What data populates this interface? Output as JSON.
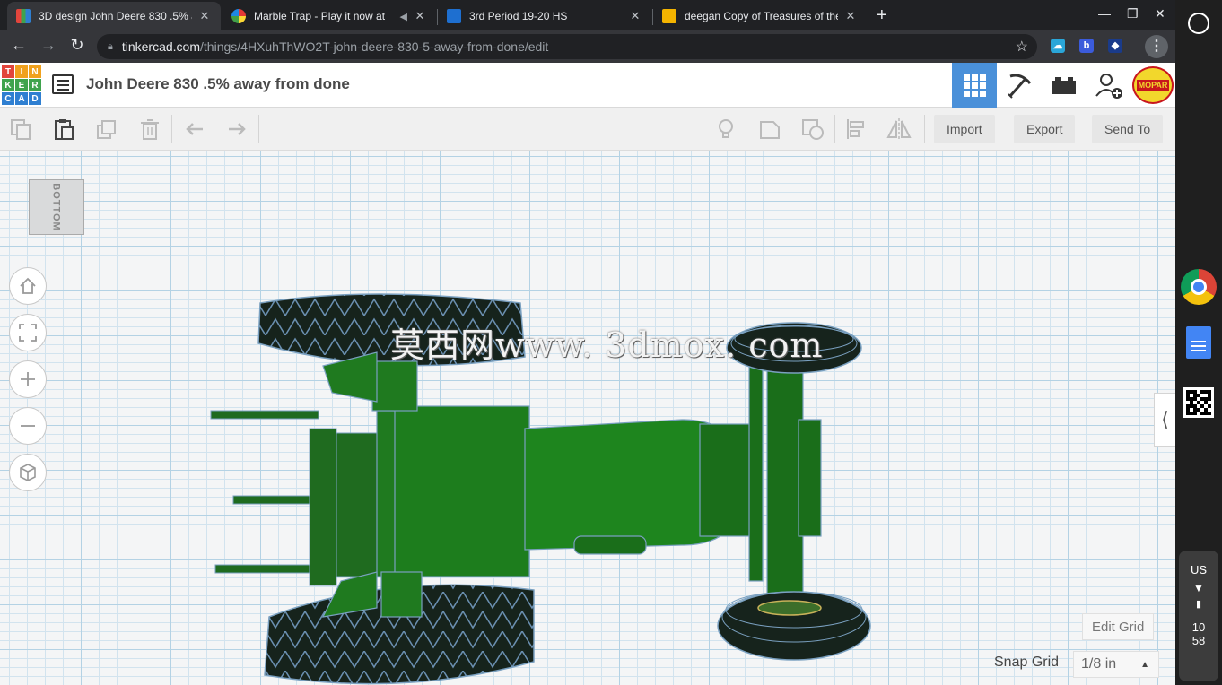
{
  "tabs": [
    {
      "title": "3D design John Deere 830 .5% a",
      "active": true
    },
    {
      "title": "Marble Trap - Play it now at",
      "active": false
    },
    {
      "title": "3rd Period 19-20 HS",
      "active": false
    },
    {
      "title": "deegan Copy of Treasures of the",
      "active": false
    }
  ],
  "address": {
    "host": "tinkercad.com",
    "path": "/things/4HXuhThWO2T-john-deere-830-5-away-from-done/edit"
  },
  "app": {
    "logo_letters": [
      "T",
      "I",
      "N",
      "K",
      "E",
      "R",
      "C",
      "A",
      "D"
    ],
    "design_title": "John Deere 830 .5% away from done",
    "avatar_text": "MOPAR"
  },
  "toolbar": {
    "import_label": "Import",
    "export_label": "Export",
    "sendto_label": "Send To"
  },
  "viewport": {
    "viewcube_face": "BOTTOM",
    "watermark": "莫西网www. 3dmox. com",
    "edit_grid_label": "Edit Grid",
    "snap_grid_label": "Snap Grid",
    "snap_grid_value": "1/8 in"
  },
  "shelf": {
    "keyboard": "US",
    "clock_hour": "10",
    "clock_min": "58"
  },
  "colors": {
    "accent": "#4a90d9",
    "tractor_green": "#1f7a1f",
    "tire_dark": "#16231c"
  }
}
